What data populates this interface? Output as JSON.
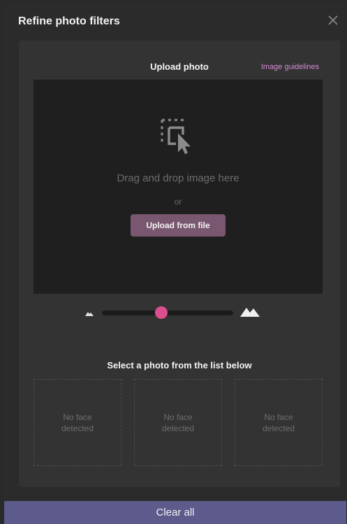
{
  "header": {
    "title": "Refine photo filters",
    "close_icon": "close-icon"
  },
  "upload": {
    "title": "Upload photo",
    "guidelines_link": "Image guidelines",
    "dropzone_text": "Drag and drop image here",
    "or_text": "or",
    "button_label": "Upload from file",
    "dropzone_icon": "drag-drop-icon"
  },
  "zoom": {
    "value": 0.45,
    "min_icon": "mountain-small-icon",
    "max_icon": "mountain-large-icon"
  },
  "faces": {
    "title": "Select a photo from the list below",
    "items": [
      {
        "label": "No face detected"
      },
      {
        "label": "No face detected"
      },
      {
        "label": "No face detected"
      }
    ]
  },
  "footer": {
    "clear_label": "Clear all"
  },
  "colors": {
    "accent": "#db4f8f",
    "button": "#7a5770",
    "link": "#d58ad6",
    "footer": "#5d5a8c"
  }
}
